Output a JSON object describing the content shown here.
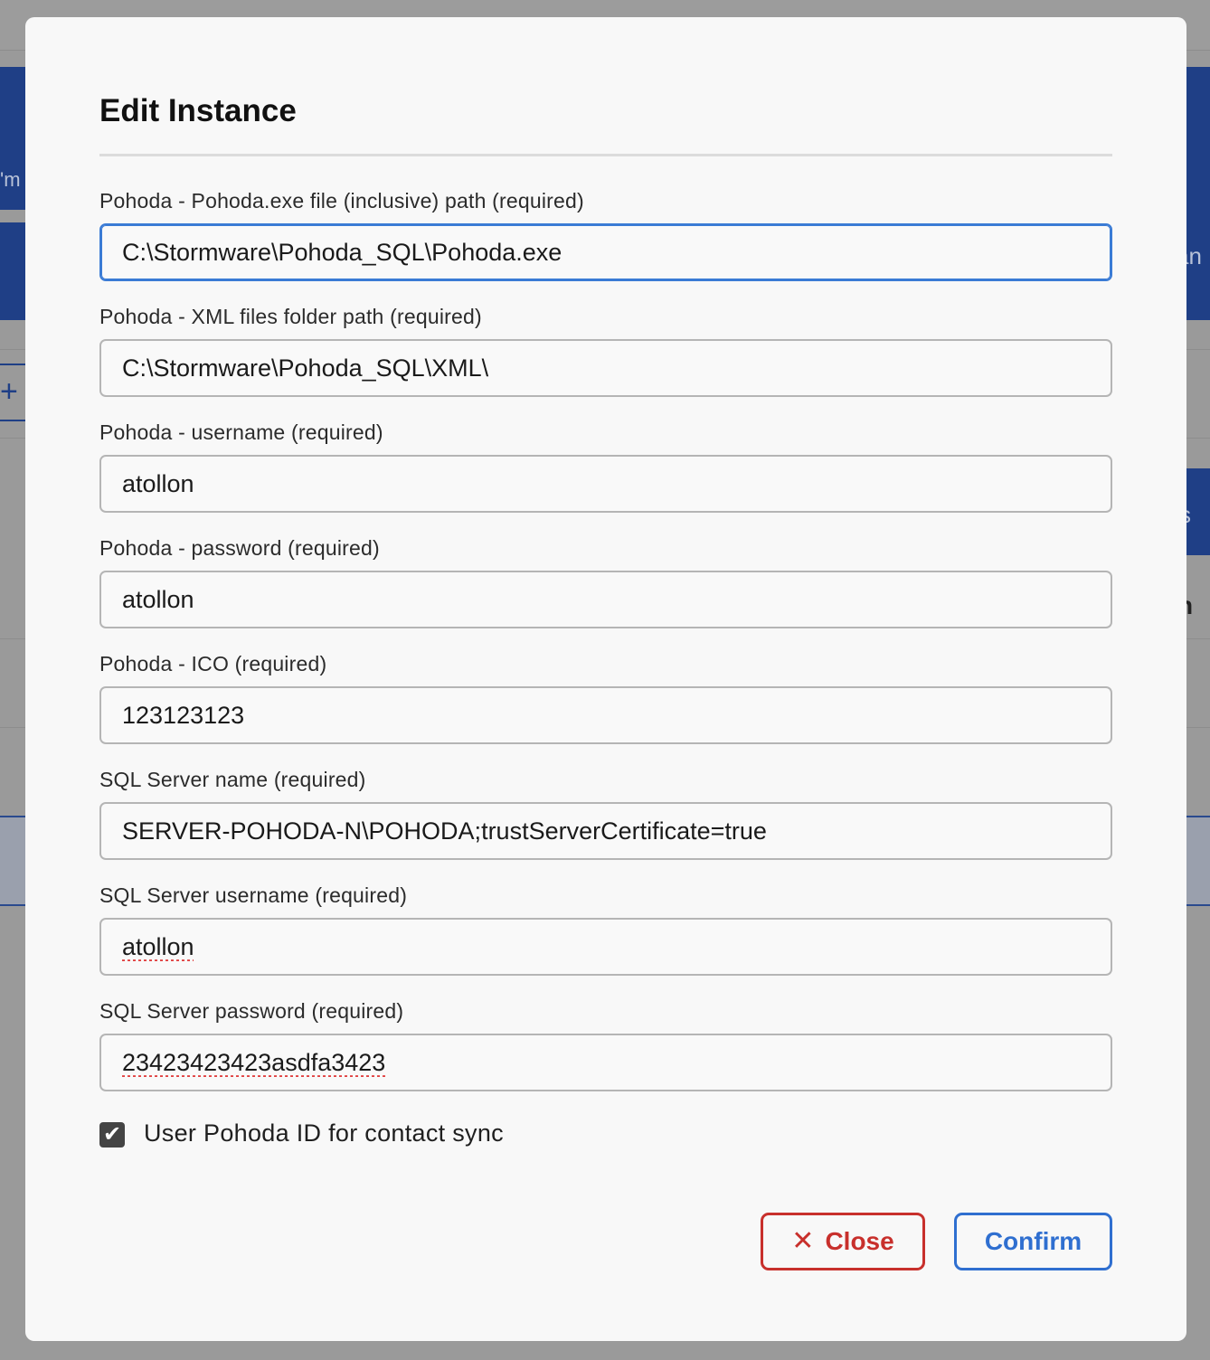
{
  "background": {
    "left_text": "'m",
    "left_plus": "+",
    "right_text_1": "an",
    "right_text_2": "s",
    "right_text_3": "n"
  },
  "modal": {
    "title": "Edit Instance",
    "fields": [
      {
        "label": "Pohoda - Pohoda.exe file (inclusive) path (required)",
        "value": "C:\\Stormware\\Pohoda_SQL\\Pohoda.exe"
      },
      {
        "label": "Pohoda - XML files folder path (required)",
        "value": "C:\\Stormware\\Pohoda_SQL\\XML\\"
      },
      {
        "label": "Pohoda - username (required)",
        "value": "atollon"
      },
      {
        "label": "Pohoda - password (required)",
        "value": "atollon"
      },
      {
        "label": "Pohoda - ICO (required)",
        "value": "123123123"
      },
      {
        "label": "SQL Server name (required)",
        "value": "SERVER-POHODA-N\\POHODA;trustServerCertificate=true"
      },
      {
        "label": "SQL Server username (required)",
        "value": "atollon"
      },
      {
        "label": "SQL Server password (required)",
        "value": "23423423423asdfa3423"
      }
    ],
    "checkbox": {
      "label": "User Pohoda ID for contact sync",
      "checked": true,
      "mark": "✔"
    },
    "buttons": {
      "close_icon": "✕",
      "close_label": "Close",
      "confirm_label": "Confirm"
    }
  },
  "colors": {
    "close": "#c8302c",
    "confirm": "#2f6fd0",
    "focus": "#3a7bd5"
  }
}
